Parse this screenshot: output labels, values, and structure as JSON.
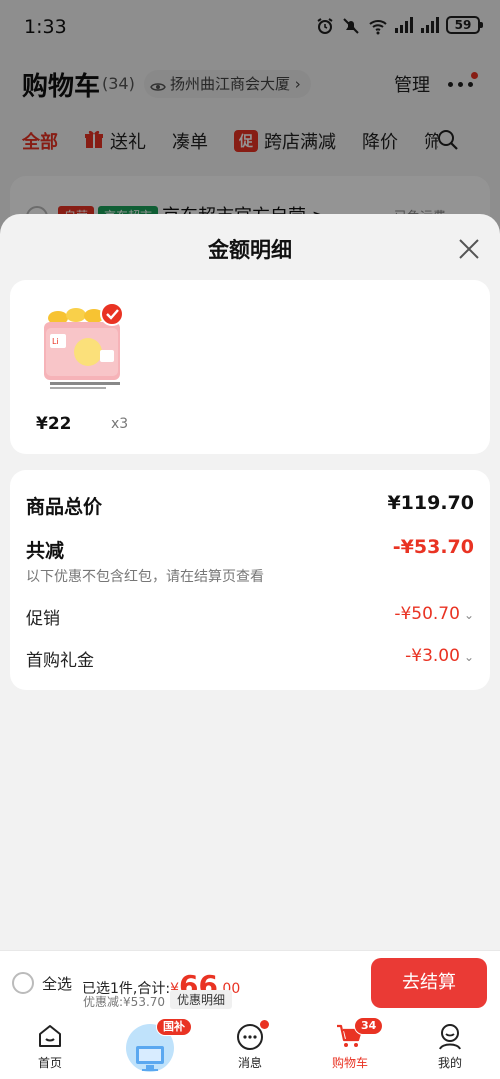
{
  "status_bar": {
    "time": "1:33",
    "battery": "59"
  },
  "header": {
    "title": "购物车",
    "count": "(34)",
    "address": "扬州曲江商会大厦",
    "manage": "管理"
  },
  "tabs": [
    {
      "label": "全部"
    },
    {
      "label": "送礼"
    },
    {
      "label": "凑单"
    },
    {
      "badge": "促",
      "label": "跨店满减"
    },
    {
      "label": "降价"
    },
    {
      "label": "筛"
    }
  ],
  "store": {
    "tag_self": "自营",
    "tag_jd": "京东超市",
    "name": "京东超市官方自营 >",
    "free_shipping": "已免运费"
  },
  "sheet": {
    "title": "金额明细",
    "product": {
      "price": "¥22",
      "qty": "x3"
    },
    "total_label": "商品总价",
    "total_value": "¥119.70",
    "reduce_label": "共减",
    "reduce_value": "-¥53.70",
    "reduce_note": "以下优惠不包含红包，请在结算页查看",
    "promo_label": "促销",
    "promo_value": "-¥50.70",
    "gift_label": "首购礼金",
    "gift_value": "-¥3.00"
  },
  "checkout": {
    "select_all": "全选",
    "summary_prefix": "已选1件,合计:",
    "currency": "¥",
    "total_int": "66",
    "total_dec": ".00",
    "discount": "优惠减:¥53.70",
    "discount_detail": "优惠明细",
    "button": "去结算"
  },
  "tabbar": {
    "items": [
      {
        "label": "首页"
      },
      {
        "label": "",
        "badge": "国补"
      },
      {
        "label": "消息"
      },
      {
        "label": "购物车",
        "badge": "34"
      },
      {
        "label": "我的"
      }
    ]
  },
  "colors": {
    "accent": "#e93323",
    "checkout_button": "#ea3a35",
    "jd_tag": "#1aa35a"
  }
}
